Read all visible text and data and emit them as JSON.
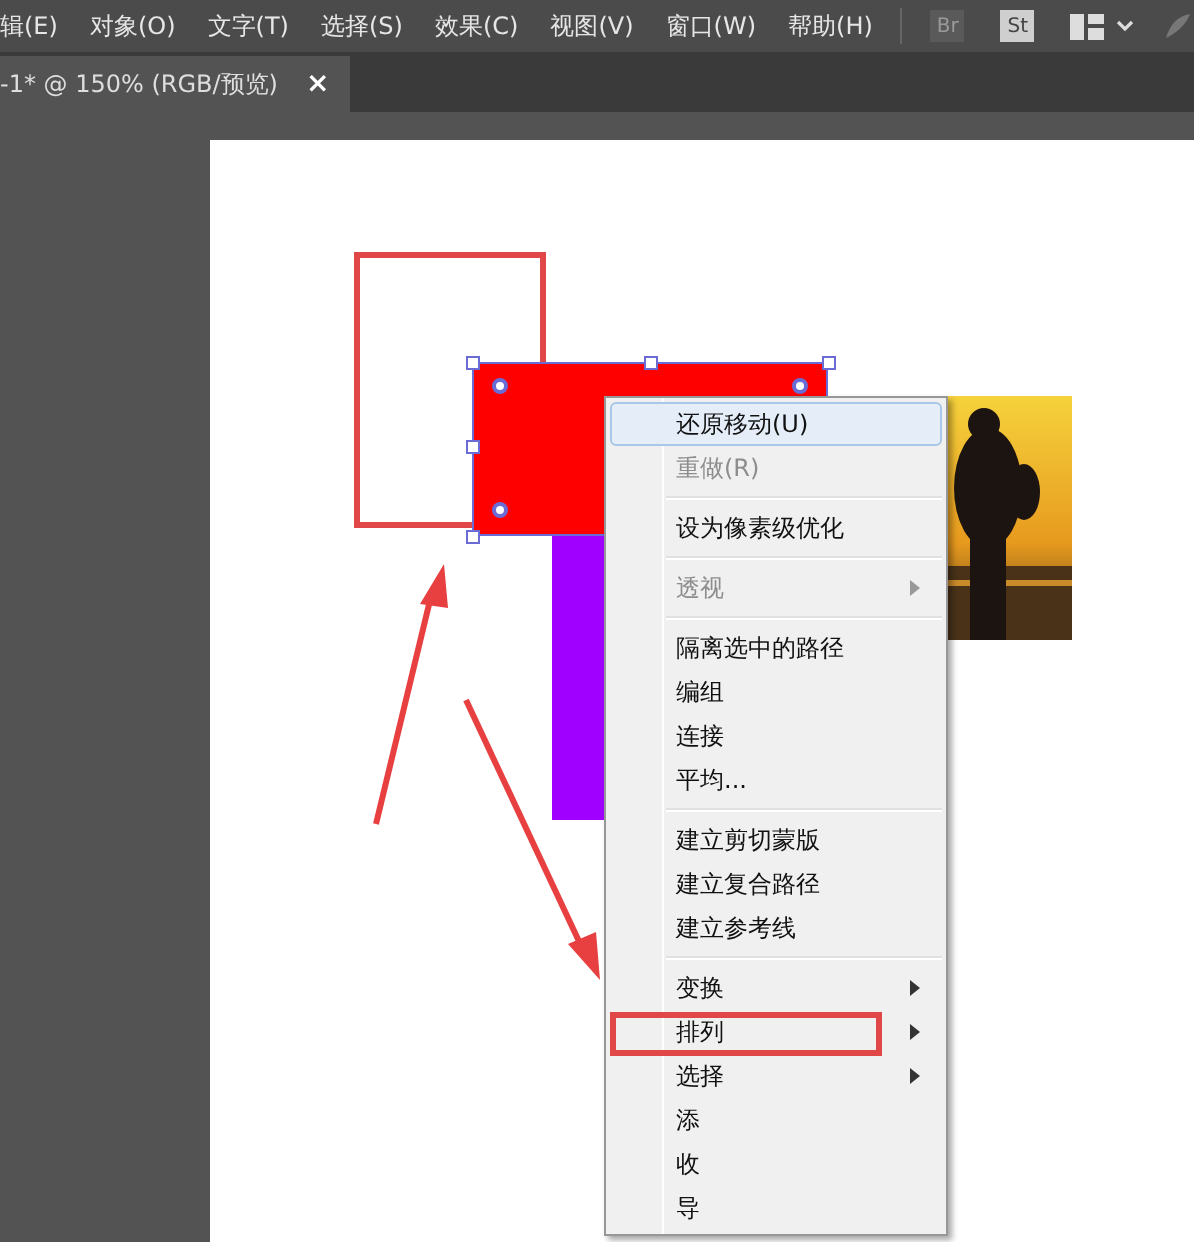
{
  "menubar": {
    "items": [
      "辑(E)",
      "对象(O)",
      "文字(T)",
      "选择(S)",
      "效果(C)",
      "视图(V)",
      "窗口(W)",
      "帮助(H)"
    ]
  },
  "app_icons": [
    {
      "label": "Br",
      "disabled": true
    },
    {
      "label": "St",
      "disabled": false
    }
  ],
  "document_tab": {
    "title": "-1* @ 150% (RGB/预览)",
    "close": "×",
    "selected": true
  },
  "context_menu": {
    "items": [
      {
        "label": "还原移动(U)",
        "highlighted": true,
        "disabled": false,
        "submenu": false,
        "separator_before": false
      },
      {
        "label": "重做(R)",
        "highlighted": false,
        "disabled": true,
        "submenu": false,
        "separator_before": false
      },
      {
        "label": "设为像素级优化",
        "highlighted": false,
        "disabled": false,
        "submenu": false,
        "separator_before": true
      },
      {
        "label": "透视",
        "highlighted": false,
        "disabled": true,
        "submenu": true,
        "separator_before": true
      },
      {
        "label": "隔离选中的路径",
        "highlighted": false,
        "disabled": false,
        "submenu": false,
        "separator_before": true
      },
      {
        "label": "编组",
        "highlighted": false,
        "disabled": false,
        "submenu": false,
        "separator_before": false
      },
      {
        "label": "连接",
        "highlighted": false,
        "disabled": false,
        "submenu": false,
        "separator_before": false
      },
      {
        "label": "平均...",
        "highlighted": false,
        "disabled": false,
        "submenu": false,
        "separator_before": false
      },
      {
        "label": "建立剪切蒙版",
        "highlighted": false,
        "disabled": false,
        "submenu": false,
        "separator_before": true
      },
      {
        "label": "建立复合路径",
        "highlighted": false,
        "disabled": false,
        "submenu": false,
        "separator_before": false
      },
      {
        "label": "建立参考线",
        "highlighted": false,
        "disabled": false,
        "submenu": false,
        "separator_before": false
      },
      {
        "label": "变换",
        "highlighted": false,
        "disabled": false,
        "submenu": true,
        "separator_before": true
      },
      {
        "label": "排列",
        "highlighted": false,
        "disabled": false,
        "submenu": true,
        "separator_before": false,
        "annotated": true
      },
      {
        "label": "选择",
        "highlighted": false,
        "disabled": false,
        "submenu": true,
        "separator_before": false
      },
      {
        "label": "添",
        "highlighted": false,
        "disabled": false,
        "submenu": false,
        "separator_before": false
      },
      {
        "label": "收",
        "highlighted": false,
        "disabled": false,
        "submenu": false,
        "separator_before": false
      },
      {
        "label": "导",
        "highlighted": false,
        "disabled": false,
        "submenu": false,
        "separator_before": false
      }
    ]
  }
}
